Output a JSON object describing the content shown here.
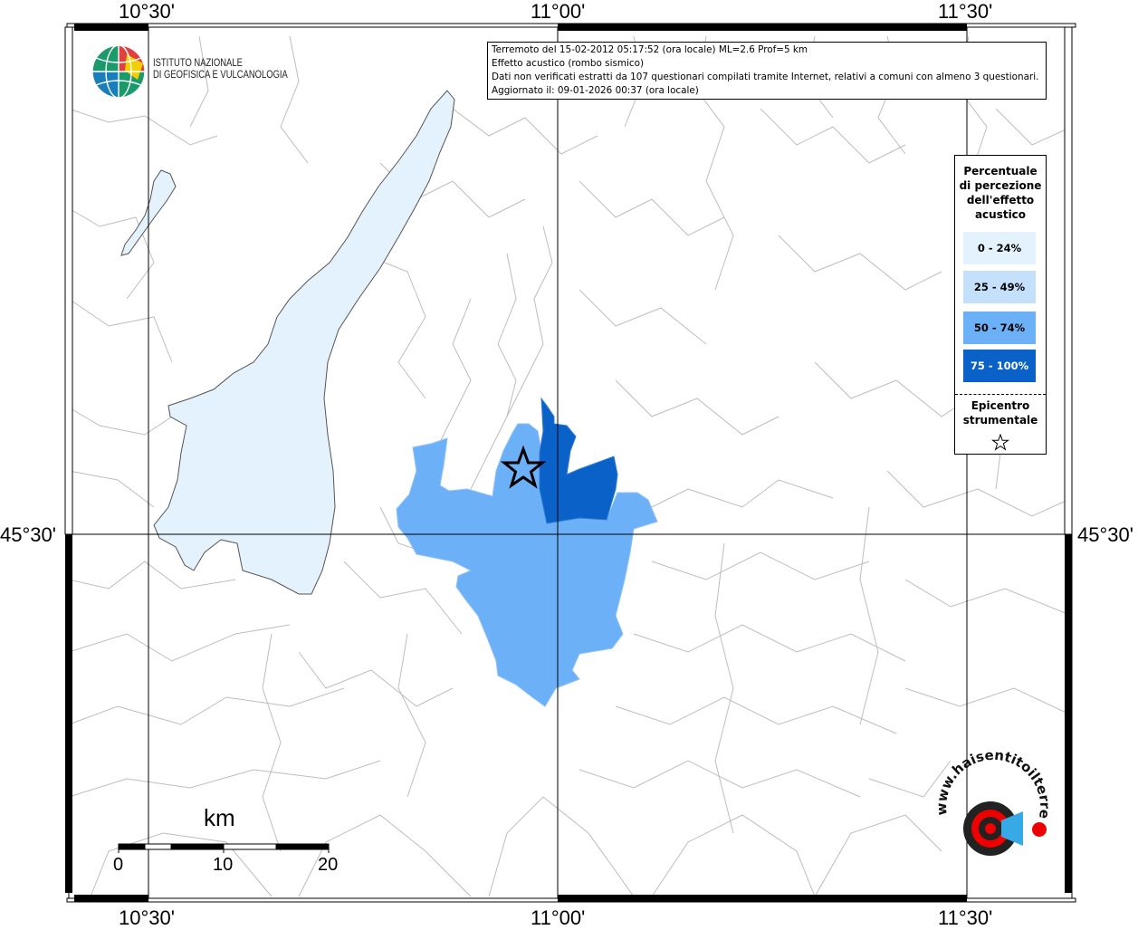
{
  "map": {
    "longitude_labels": [
      "10°30'",
      "11°00'",
      "11°30'"
    ],
    "latitude_labels": [
      "45°30'",
      "45°30'"
    ]
  },
  "logo": {
    "line1": "ISTITUTO NAZIONALE",
    "line2": "DI GEOFISICA E VULCANOLOGIA"
  },
  "info": {
    "line1": "Terremoto del 15-02-2012 05:17:52 (ora locale) ML=2.6 Prof=5 km",
    "line2": "Effetto acustico (rombo sismico)",
    "line3": "Dati non verificati estratti da 107 questionari compilati tramite Internet, relativi a comuni con almeno 3 questionari.",
    "line4": "Aggiornato il: 09-01-2026 00:37 (ora locale)"
  },
  "legend": {
    "title_lines": [
      "Percentuale",
      "di percezione",
      "dell'effetto",
      "acustico"
    ],
    "classes": [
      {
        "label": "0 - 24%",
        "color": "#e3f2fd",
        "text_color": "#000000"
      },
      {
        "label": "25 - 49%",
        "color": "#c4e0fa",
        "text_color": "#000000"
      },
      {
        "label": "50 - 74%",
        "color": "#6cb0f7",
        "text_color": "#000000"
      },
      {
        "label": "75 - 100%",
        "color": "#0a62c9",
        "text_color": "#ffffff"
      }
    ],
    "epicenter_lines": [
      "Epicentro",
      "strumentale"
    ],
    "epicenter_symbol": "star-icon"
  },
  "scalebar": {
    "unit": "km",
    "labels": [
      "0",
      "10",
      "20"
    ]
  },
  "brand": {
    "text": "www.haisentitoilterremoto.it",
    "icon": "loudspeaker-target-icon"
  },
  "colors": {
    "lake": "#e3f2fd",
    "class_50_74": "#6cb0f7",
    "class_75_100": "#0a62c9",
    "borders": "#bbbbbb"
  }
}
